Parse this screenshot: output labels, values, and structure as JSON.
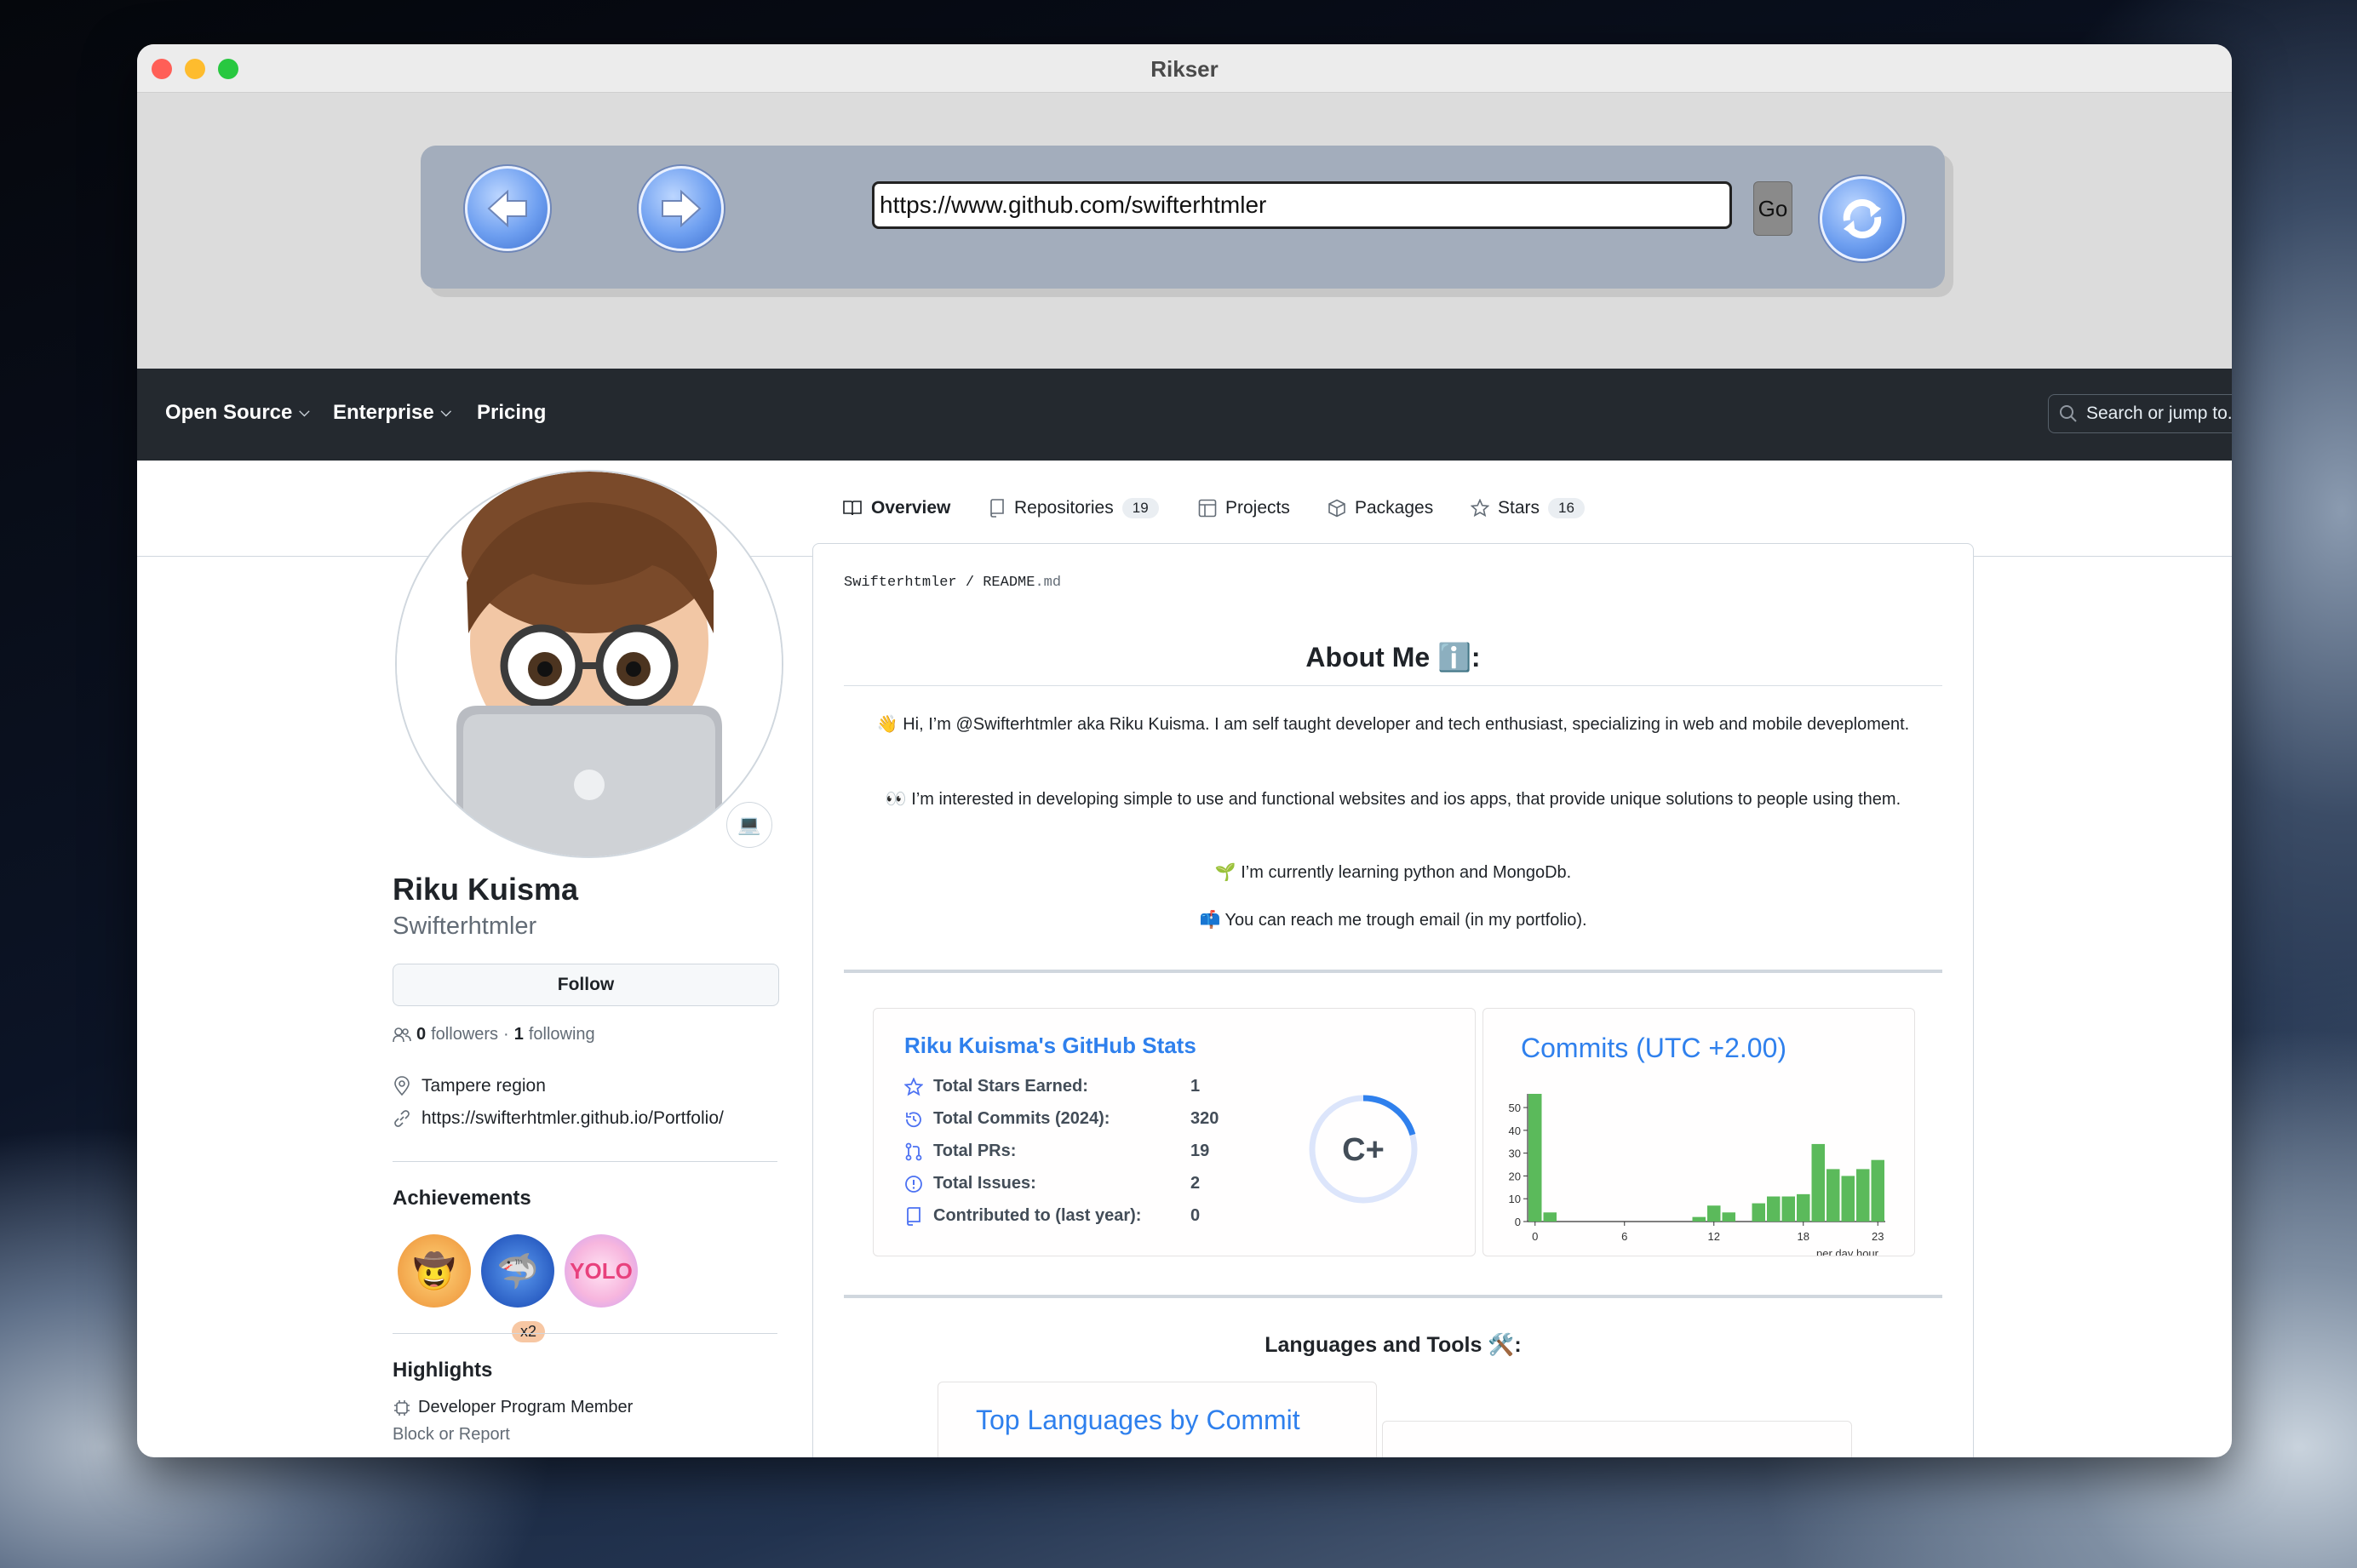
{
  "window": {
    "title": "Rikser"
  },
  "browser": {
    "url": "https://www.github.com/swifterhtmler",
    "go_label": "Go"
  },
  "gh_nav": {
    "items": [
      {
        "label": "Open Source",
        "dropdown": true
      },
      {
        "label": "Enterprise",
        "dropdown": true
      },
      {
        "label": "Pricing",
        "dropdown": false
      }
    ],
    "search_placeholder": "Search or jump to..."
  },
  "tabs": [
    {
      "label": "Overview",
      "count": ""
    },
    {
      "label": "Repositories",
      "count": "19"
    },
    {
      "label": "Projects",
      "count": ""
    },
    {
      "label": "Packages",
      "count": ""
    },
    {
      "label": "Stars",
      "count": "16"
    }
  ],
  "profile": {
    "status_emoji": "💻",
    "name": "Riku Kuisma",
    "login": "Swifterhtmler",
    "follow_label": "Follow",
    "followers": "0",
    "followers_label": "followers",
    "following": "1",
    "following_label": "following",
    "location": "Tampere region",
    "website": "https://swifterhtmler.github.io/Portfolio/",
    "achievements_title": "Achievements",
    "achievements": [
      {
        "icon": "🤠",
        "count": ""
      },
      {
        "icon": "🦈",
        "count": "x2"
      },
      {
        "icon": "YOLO",
        "count": ""
      }
    ],
    "highlights_title": "Highlights",
    "highlight_item": "Developer Program Member",
    "block_label": "Block or Report"
  },
  "readme": {
    "owner": "Swifterhtmler",
    "file": "README",
    "ext": ".md",
    "about_title": "About Me ℹ️:",
    "p1": "👋 Hi, I’m @Swifterhtmler aka Riku Kuisma. I am self taught developer and tech enthusiast, specializing in web and mobile deveploment.",
    "p2": "👀 I’m interested in developing simple to use and functional websites and ios apps, that provide unique solutions to people using them.",
    "p3": "🌱 I’m currently learning python and MongoDb.",
    "p4": "📫 You can reach me trough email (in my portfolio).",
    "stats": {
      "title": "Riku Kuisma's GitHub Stats",
      "rows": [
        {
          "label": "Total Stars Earned:",
          "value": "1",
          "icon": "star-icon"
        },
        {
          "label": "Total Commits (2024):",
          "value": "320",
          "icon": "history-icon"
        },
        {
          "label": "Total PRs:",
          "value": "19",
          "icon": "pull-request-icon"
        },
        {
          "label": "Total Issues:",
          "value": "2",
          "icon": "issue-icon"
        },
        {
          "label": "Contributed to (last year):",
          "value": "0",
          "icon": "repo-icon"
        }
      ],
      "rank": "C+"
    },
    "commits": {
      "title": "Commits (UTC +2.00)",
      "xlabel": "per day hour"
    },
    "languages_title": "Languages and Tools 🛠️:",
    "lang_card_title": "Top Languages by Commit"
  },
  "chart_data": {
    "type": "bar",
    "title": "Commits (UTC +2.00)",
    "xlabel": "per day hour",
    "ylabel": "",
    "categories": [
      0,
      1,
      2,
      3,
      4,
      5,
      6,
      7,
      8,
      9,
      10,
      11,
      12,
      13,
      14,
      15,
      16,
      17,
      18,
      19,
      20,
      21,
      22,
      23
    ],
    "values": [
      56,
      4,
      0,
      0,
      0,
      0,
      0,
      0,
      0,
      0,
      0,
      2,
      7,
      4,
      0,
      8,
      11,
      11,
      12,
      34,
      23,
      20,
      23,
      27
    ],
    "ylim": [
      0,
      56
    ],
    "yticks": [
      0,
      10,
      20,
      30,
      40,
      50
    ],
    "xticks": [
      0,
      6,
      12,
      18,
      23
    ],
    "color": "#5bba5b"
  }
}
